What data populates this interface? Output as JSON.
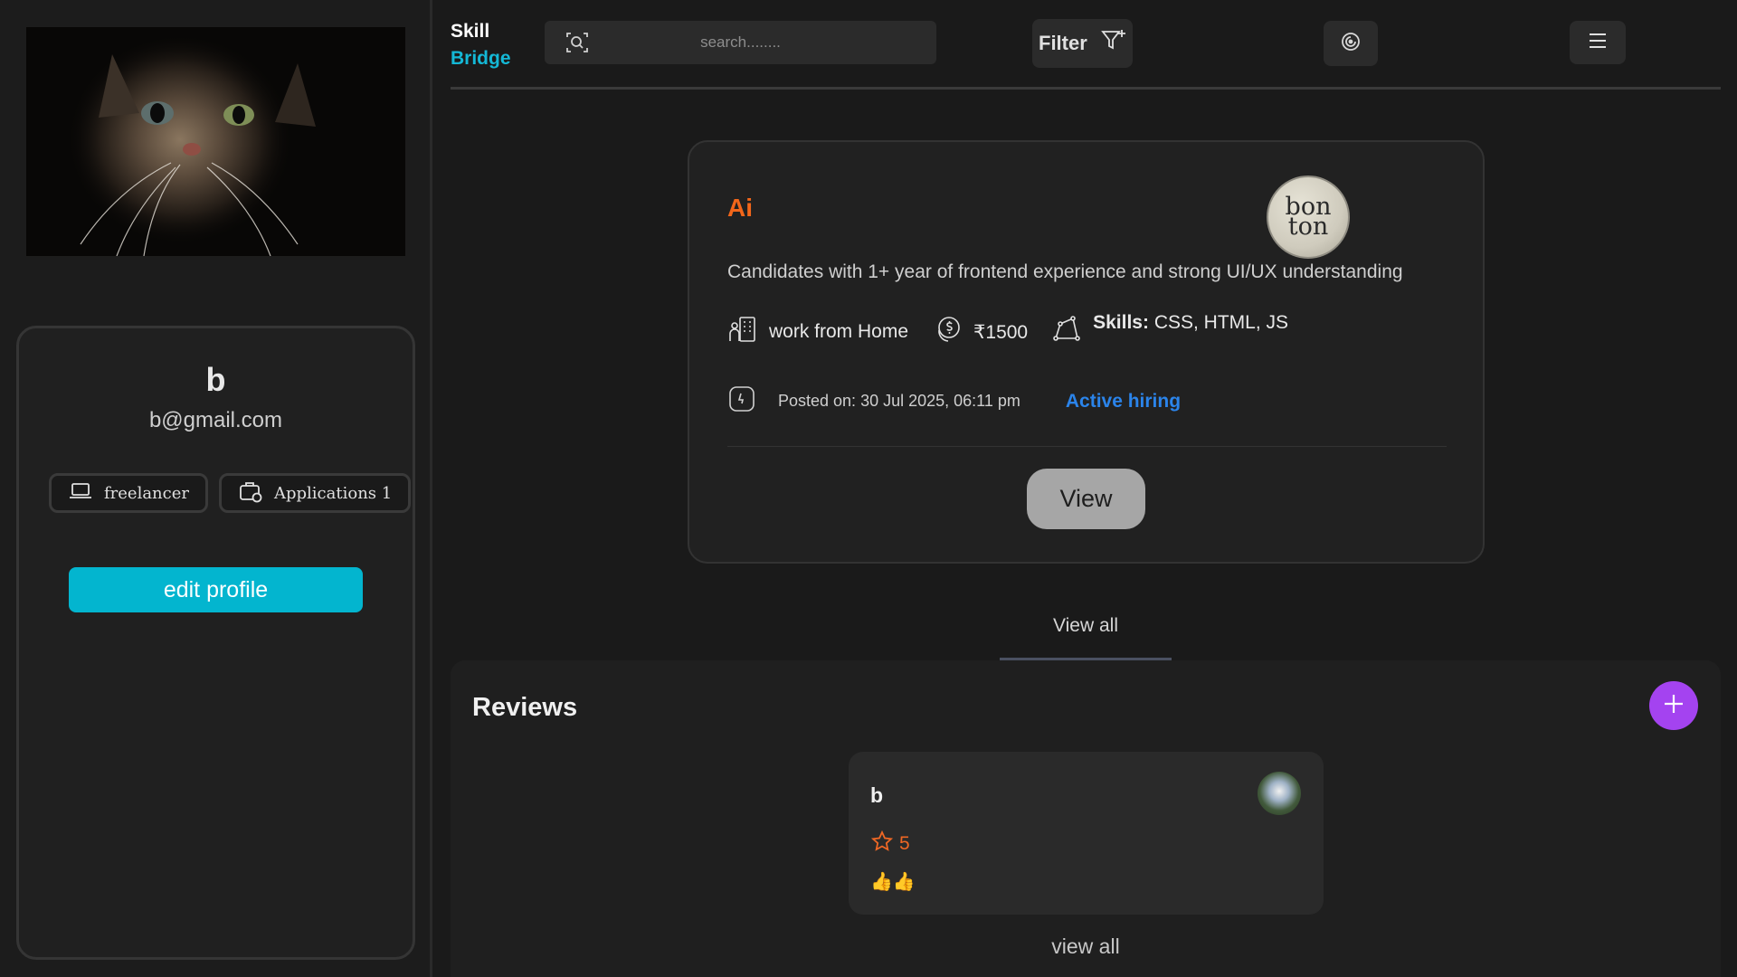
{
  "brand": {
    "line1": "Skill",
    "line2": "Bridge"
  },
  "search": {
    "placeholder": "search........"
  },
  "filter": {
    "label": "Filter"
  },
  "profile": {
    "name": "b",
    "email": "b@gmail.com",
    "role_chip": "freelancer",
    "applications_chip": "Applications 1",
    "edit_label": "edit profile"
  },
  "job": {
    "title": "Ai",
    "company_logo_text": "bon ton",
    "description": "Candidates with 1+ year of frontend experience and strong UI/UX understanding",
    "work_mode": "work from Home",
    "salary": "₹1500",
    "skills_label": "Skills:",
    "skills_value": " CSS, HTML, JS",
    "posted": "Posted on: 30 Jul 2025, 06:11 pm",
    "status": "Active hiring",
    "view_label": "View"
  },
  "view_all_label": "View all",
  "reviews": {
    "title": "Reviews",
    "items": [
      {
        "name": "b",
        "rating": "5",
        "text": "👍👍"
      }
    ],
    "view_all_label": "view all"
  },
  "icons": {
    "search": "search-icon",
    "filter": "filter-plus-icon",
    "theme": "theme-toggle-icon",
    "menu": "hamburger-menu-icon",
    "role": "laptop-icon",
    "applications": "briefcase-icon",
    "work_mode": "building-person-icon",
    "salary": "coin-dollar-icon",
    "skills": "shapes-icon",
    "posted": "clock-icon",
    "rating": "star-icon",
    "add": "plus-icon"
  },
  "colors": {
    "accent_cyan": "#03b5cf",
    "job_title_orange": "#f2661a",
    "active_blue": "#2b84ea",
    "add_purple": "#a443f0",
    "rating_orange": "#ef6724"
  }
}
